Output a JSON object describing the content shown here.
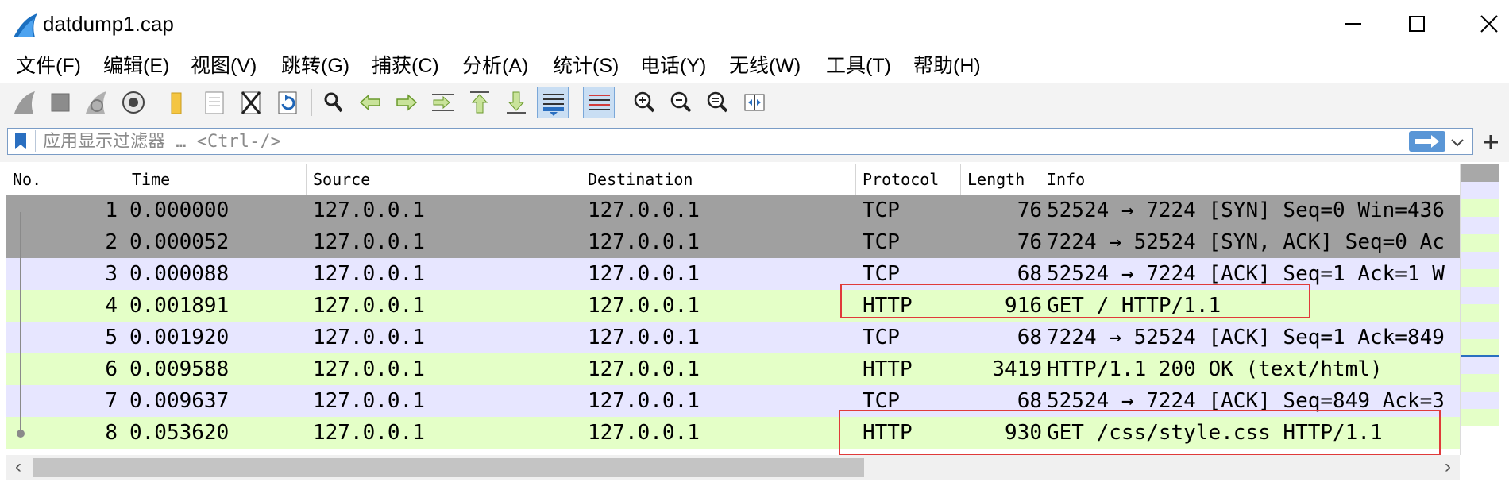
{
  "window": {
    "title": "datdump1.cap",
    "app_icon": "wireshark-fin-icon",
    "controls": [
      "minimize-icon",
      "maximize-icon",
      "close-icon"
    ]
  },
  "menu": {
    "items": [
      "文件(F)",
      "编辑(E)",
      "视图(V)",
      "跳转(G)",
      "捕获(C)",
      "分析(A)",
      "统计(S)",
      "电话(Y)",
      "无线(W)",
      "工具(T)",
      "帮助(H)"
    ]
  },
  "toolbar": {
    "icons": [
      "start-capture-icon",
      "stop-capture-icon",
      "restart-capture-icon",
      "capture-options-icon",
      "open-file-icon",
      "save-file-icon",
      "close-file-icon",
      "reload-file-icon",
      "find-packet-icon",
      "go-back-icon",
      "go-forward-icon",
      "go-to-packet-icon",
      "go-first-icon",
      "go-last-icon",
      "autoscroll-icon",
      "colorize-icon",
      "zoom-in-icon",
      "zoom-out-icon",
      "normal-size-icon",
      "resize-columns-icon"
    ]
  },
  "filter": {
    "placeholder": "应用显示过滤器 … <Ctrl-/>",
    "value": "",
    "apply_icon": "arrow-right-icon",
    "dropdown_icon": "chevron-down-icon",
    "add_icon": "plus-icon"
  },
  "columns": [
    "No.",
    "Time",
    "Source",
    "Destination",
    "Protocol",
    "Length",
    "Info"
  ],
  "packets": [
    {
      "no": "1",
      "time": "0.000000",
      "source": "127.0.0.1",
      "destination": "127.0.0.1",
      "protocol": "TCP",
      "length": "76",
      "info": "52524 → 7224 [SYN] Seq=0 Win=436",
      "bg": "#a0a0a0"
    },
    {
      "no": "2",
      "time": "0.000052",
      "source": "127.0.0.1",
      "destination": "127.0.0.1",
      "protocol": "TCP",
      "length": "76",
      "info": "7224 → 52524 [SYN, ACK] Seq=0 Ac",
      "bg": "#a0a0a0"
    },
    {
      "no": "3",
      "time": "0.000088",
      "source": "127.0.0.1",
      "destination": "127.0.0.1",
      "protocol": "TCP",
      "length": "68",
      "info": "52524 → 7224 [ACK] Seq=1 Ack=1 W",
      "bg": "#e7e6ff"
    },
    {
      "no": "4",
      "time": "0.001891",
      "source": "127.0.0.1",
      "destination": "127.0.0.1",
      "protocol": "HTTP",
      "length": "916",
      "info": "GET / HTTP/1.1",
      "bg": "#e4ffc7"
    },
    {
      "no": "5",
      "time": "0.001920",
      "source": "127.0.0.1",
      "destination": "127.0.0.1",
      "protocol": "TCP",
      "length": "68",
      "info": "7224 → 52524 [ACK] Seq=1 Ack=849",
      "bg": "#e7e6ff"
    },
    {
      "no": "6",
      "time": "0.009588",
      "source": "127.0.0.1",
      "destination": "127.0.0.1",
      "protocol": "HTTP",
      "length": "3419",
      "info": "HTTP/1.1 200 OK  (text/html)",
      "bg": "#e4ffc7"
    },
    {
      "no": "7",
      "time": "0.009637",
      "source": "127.0.0.1",
      "destination": "127.0.0.1",
      "protocol": "TCP",
      "length": "68",
      "info": "52524 → 7224 [ACK] Seq=849 Ack=3",
      "bg": "#e7e6ff"
    },
    {
      "no": "8",
      "time": "0.053620",
      "source": "127.0.0.1",
      "destination": "127.0.0.1",
      "protocol": "HTTP",
      "length": "930",
      "info": "GET /css/style.css HTTP/1.1",
      "bg": "#e4ffc7"
    }
  ],
  "scrollbars": {
    "left_arrow": "‹",
    "right_arrow": "›"
  }
}
